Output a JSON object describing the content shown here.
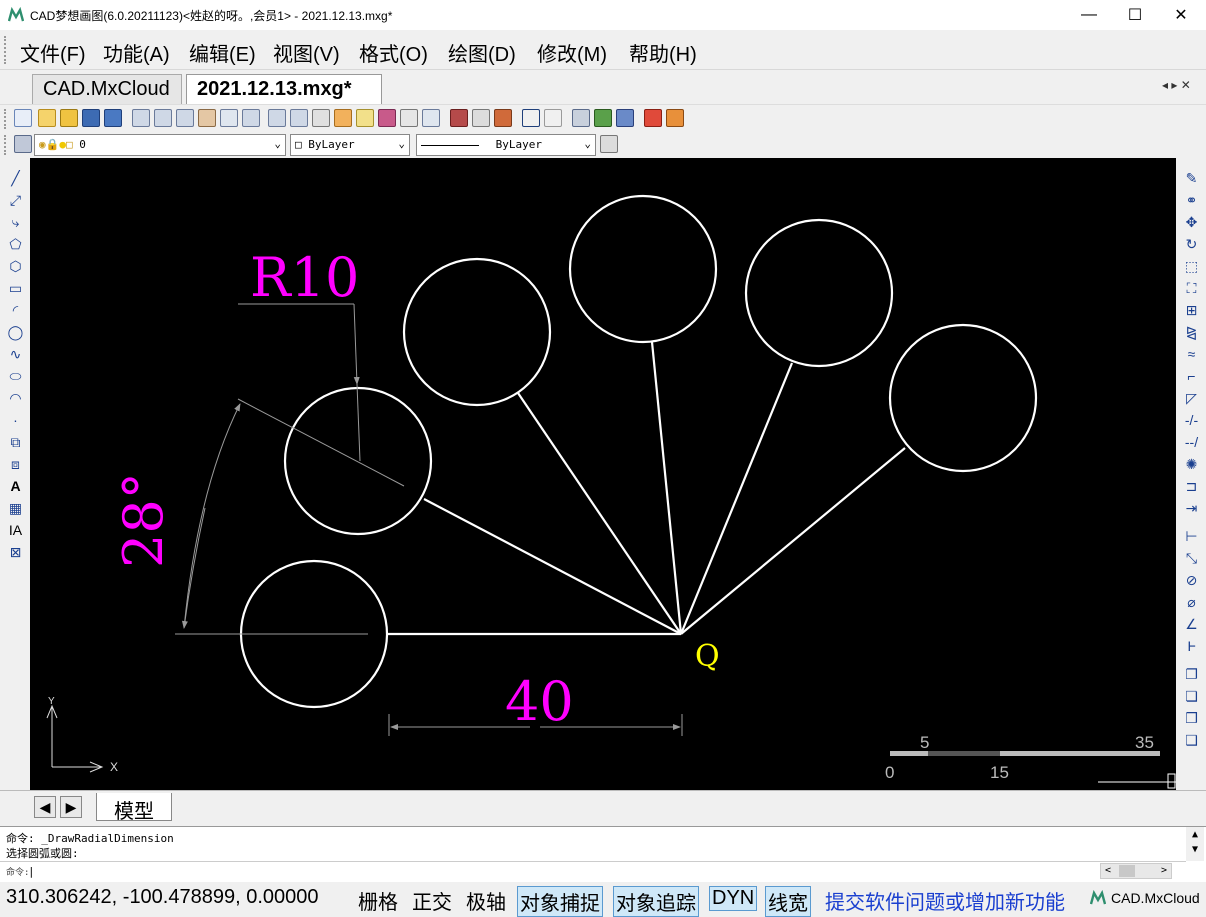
{
  "window": {
    "title": "CAD梦想画图(6.0.20211123)<姓赵的呀。,会员1> - 2021.12.13.mxg*",
    "controls": [
      "—",
      "☐",
      "✕"
    ]
  },
  "menu": [
    "文件(F)",
    "功能(A)",
    "编辑(E)",
    "视图(V)",
    "格式(O)",
    "绘图(D)",
    "修改(M)",
    "帮助(H)"
  ],
  "tabs": [
    "CAD.MxCloud",
    "2021.12.13.mxg*"
  ],
  "tab_controls": "◂ ▸ ✕",
  "toolbar2": {
    "layer_value": "0",
    "color_value": "ByLayer",
    "linetype_value": "ByLayer"
  },
  "drawing": {
    "radius_label": "R10",
    "angle_label": "28°",
    "length_label": "40",
    "point_label": "Q",
    "scale_top": [
      "5",
      "35"
    ],
    "scale_bottom": [
      "0",
      "15"
    ],
    "ucs_y": "Y",
    "ucs_x": "X",
    "colors": {
      "background": "#000000",
      "geometry": "#ffffff",
      "dimension_text": "#ff00ff",
      "point_text": "#ffff00",
      "dimension_line": "#9a9a9a"
    }
  },
  "layout_tab": "模型",
  "command": {
    "line1": "命令: _DrawRadialDimension",
    "line2": " 选择圆弧或圆:",
    "prompt": "命令:"
  },
  "status": {
    "coordinates": "310.306242,  -100.478899,  0.00000",
    "toggles": [
      {
        "label": "栅格",
        "on": false
      },
      {
        "label": "正交",
        "on": false
      },
      {
        "label": "极轴",
        "on": false
      },
      {
        "label": "对象捕捉",
        "on": true
      },
      {
        "label": "对象追踪",
        "on": true
      },
      {
        "label": "DYN",
        "on": true
      },
      {
        "label": "线宽",
        "on": true
      }
    ],
    "feedback_link": "提交软件问题或增加新功能",
    "brand": "CAD.MxCloud"
  }
}
